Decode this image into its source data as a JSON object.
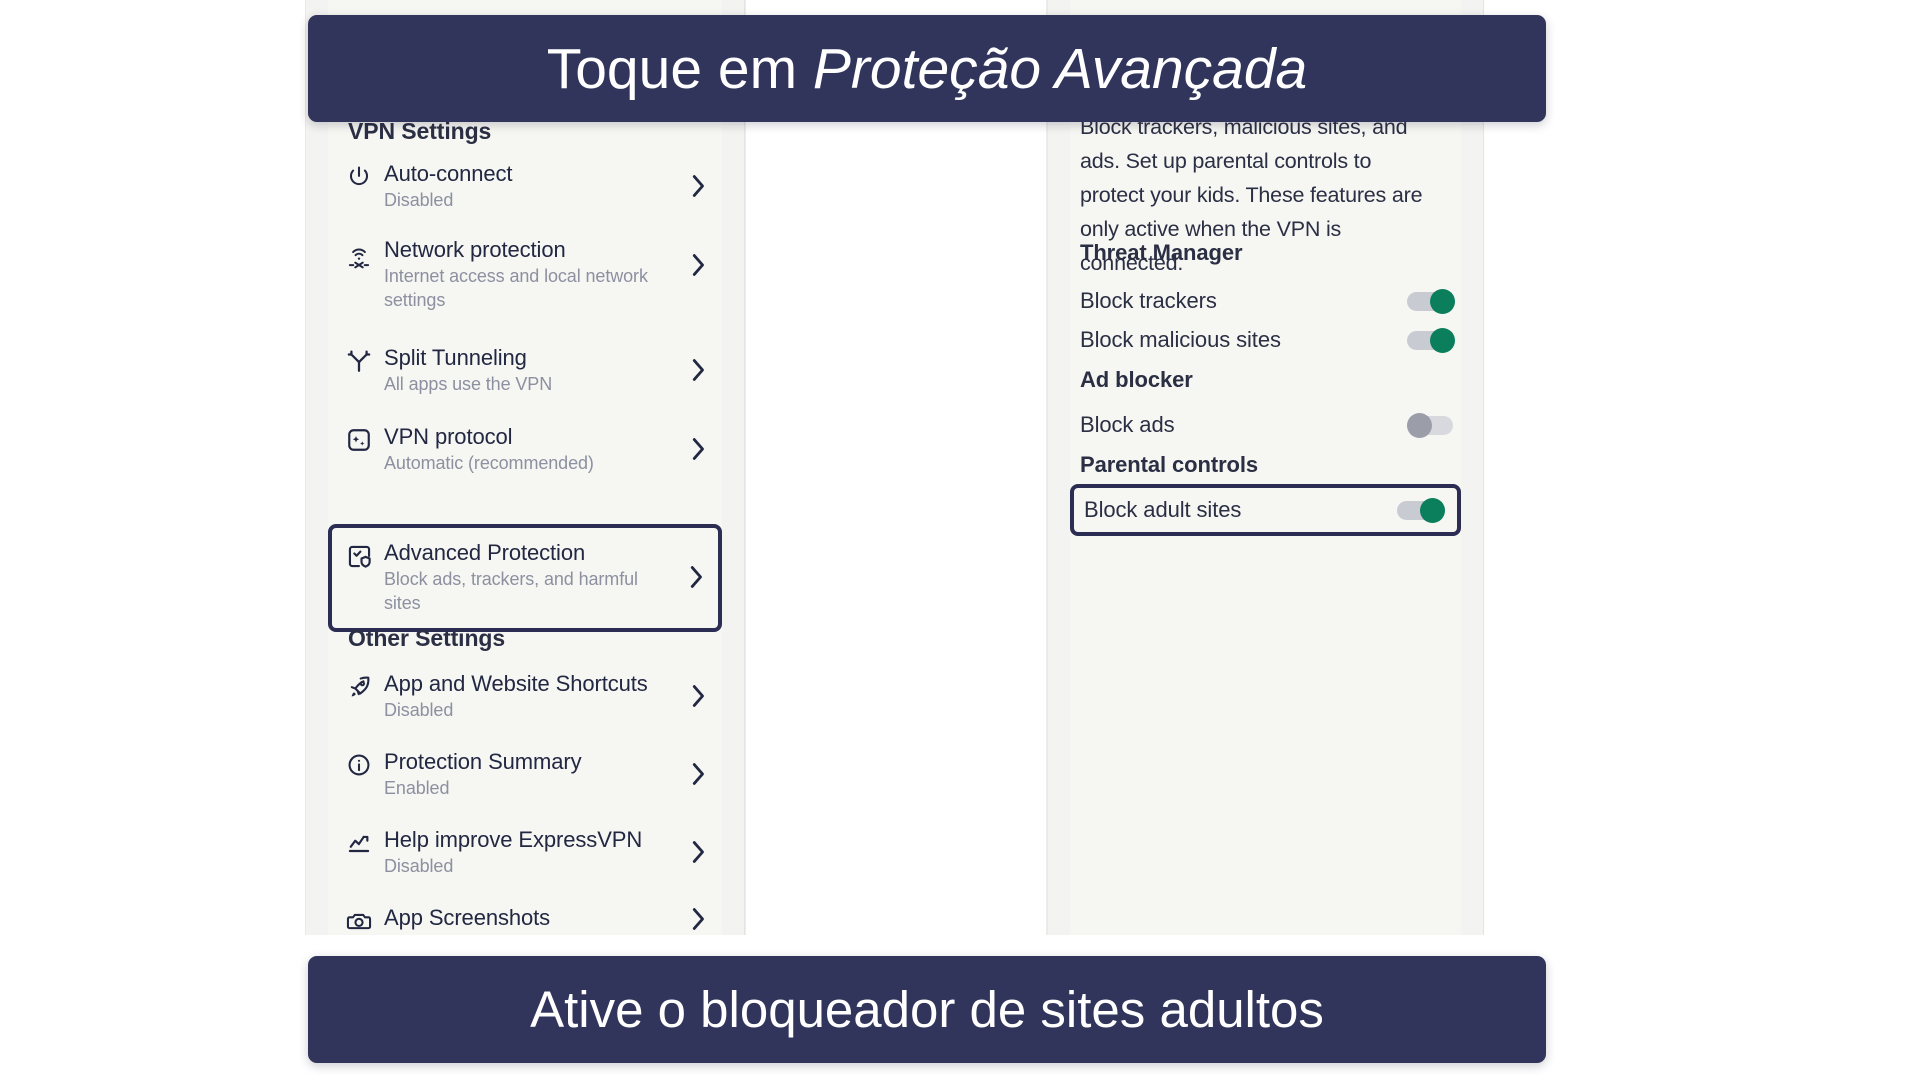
{
  "banners": {
    "top": {
      "prefix": "Toque em ",
      "emphasis": "Proteção Avançada"
    },
    "bottom": {
      "text": "Ative o bloqueador de sites adultos"
    }
  },
  "colors": {
    "banner_bg": "#32355b",
    "panel_bg": "#f6f6f2",
    "highlight_border": "#2b2d52",
    "toggle_on": "#0b7f5c",
    "toggle_off_knob": "#9b9ea9",
    "toggle_track": "#c9cbd2",
    "text_primary": "#222742",
    "text_secondary": "#8c90a0"
  },
  "left_panel": {
    "section_vpn": {
      "title": "VPN Settings"
    },
    "vpn_items": [
      {
        "icon": "power-icon",
        "title": "Auto-connect",
        "subtitle": "Disabled",
        "highlighted": false
      },
      {
        "icon": "network-icon",
        "title": "Network protection",
        "subtitle": "Internet access and local network settings",
        "highlighted": false
      },
      {
        "icon": "split-icon",
        "title": "Split Tunneling",
        "subtitle": "All apps use the VPN",
        "highlighted": false
      },
      {
        "icon": "protocol-icon",
        "title": "VPN protocol",
        "subtitle": "Automatic (recommended)",
        "highlighted": false
      },
      {
        "icon": "shield-check-icon",
        "title": "Advanced Protection",
        "subtitle": "Block ads, trackers, and harmful sites",
        "highlighted": true
      }
    ],
    "section_other": {
      "title": "Other Settings"
    },
    "other_items": [
      {
        "icon": "rocket-icon",
        "title": "App and Website Shortcuts",
        "subtitle": "Disabled",
        "highlighted": false
      },
      {
        "icon": "info-icon",
        "title": "Protection Summary",
        "subtitle": "Enabled",
        "highlighted": false
      },
      {
        "icon": "chart-icon",
        "title": "Help improve ExpressVPN",
        "subtitle": "Disabled",
        "highlighted": false
      },
      {
        "icon": "camera-icon",
        "title": "App Screenshots",
        "subtitle": "",
        "highlighted": false
      }
    ]
  },
  "right_panel": {
    "description": "Block trackers, malicious sites, and ads. Set up parental controls to protect your kids. These features are only active when the VPN is connected.",
    "groups": [
      {
        "heading": "Threat Manager",
        "rows": [
          {
            "label": "Block trackers",
            "state": "on",
            "highlighted": false
          },
          {
            "label": "Block malicious sites",
            "state": "on",
            "highlighted": false
          }
        ]
      },
      {
        "heading": "Ad blocker",
        "rows": [
          {
            "label": "Block ads",
            "state": "off",
            "highlighted": false
          }
        ]
      },
      {
        "heading": "Parental controls",
        "rows": [
          {
            "label": "Block adult sites",
            "state": "on",
            "highlighted": true
          }
        ]
      }
    ]
  }
}
